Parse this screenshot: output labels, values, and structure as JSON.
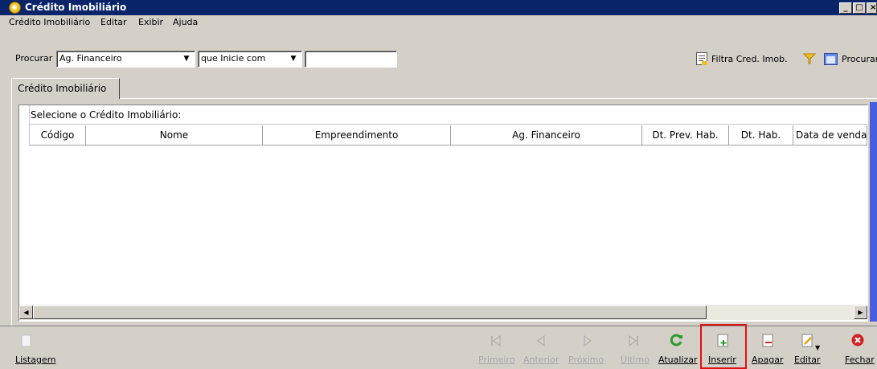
{
  "window": {
    "title": "Crédito Imobiliário",
    "controls": [
      "_",
      "□",
      "×"
    ]
  },
  "menu": [
    "Crédito Imobiliário",
    "Editar",
    "Exibir",
    "Ajuda"
  ],
  "search": {
    "label": "Procurar",
    "field_value": "Ag. Financeiro",
    "mode_value": "que Inicie com",
    "text_value": ""
  },
  "actions": {
    "filter_label": "Filtra Cred. Imob.",
    "search_label": "Procurar"
  },
  "tab": {
    "label": "Crédito Imobiliário"
  },
  "grid": {
    "caption": "Selecione o Crédito Imobiliário:",
    "columns": [
      "Código",
      "Nome",
      "Empreendimento",
      "Ag. Financeiro",
      "Dt. Prev. Hab.",
      "Dt. Hab.",
      "Data de venda"
    ],
    "rows": []
  },
  "toolbar": {
    "listagem": "Listagem",
    "primeiro": "Primeiro",
    "anterior": "Anterior",
    "proximo": "Próximo",
    "ultimo": "Último",
    "atualizar": "Atualizar",
    "inserir": "Inserir",
    "apagar": "Apagar",
    "editar": "Editar",
    "fechar": "Fechar"
  },
  "colors": {
    "titlebar": "#0a246a",
    "highlight": "#e01010",
    "refresh_green": "#2e9a2e",
    "close_red": "#d02020"
  }
}
